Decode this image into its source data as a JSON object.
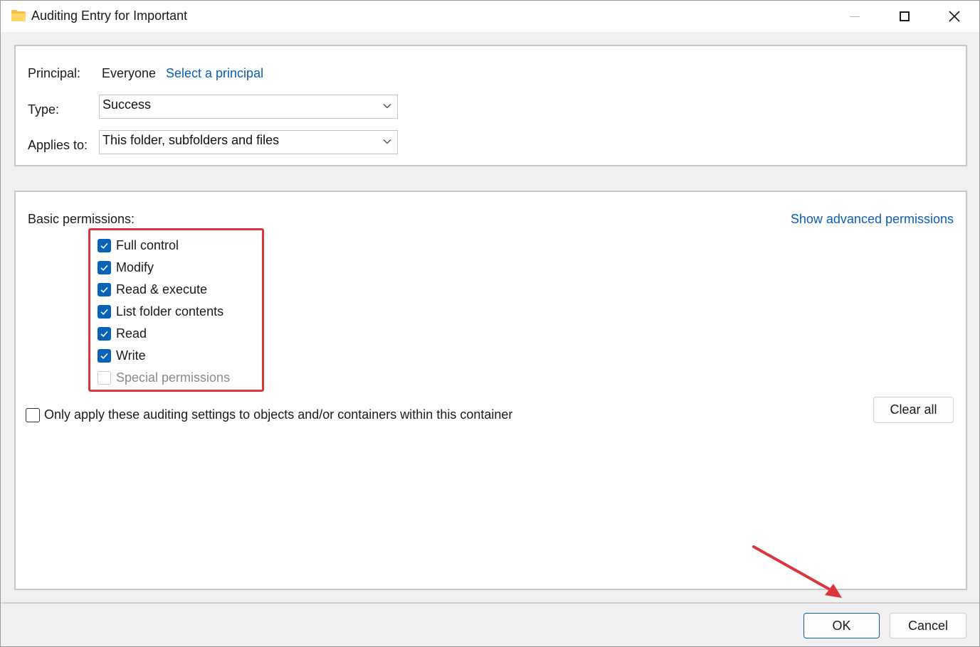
{
  "window": {
    "title": "Auditing Entry for Important"
  },
  "principal": {
    "label": "Principal:",
    "value": "Everyone",
    "link": "Select a principal"
  },
  "type": {
    "label": "Type:",
    "selected": "Success"
  },
  "applies_to": {
    "label": "Applies to:",
    "selected": "This folder, subfolders and files"
  },
  "permissions": {
    "heading": "Basic permissions:",
    "advanced_link": "Show advanced permissions",
    "items": [
      {
        "label": "Full control",
        "checked": true,
        "enabled": true
      },
      {
        "label": "Modify",
        "checked": true,
        "enabled": true
      },
      {
        "label": "Read & execute",
        "checked": true,
        "enabled": true
      },
      {
        "label": "List folder contents",
        "checked": true,
        "enabled": true
      },
      {
        "label": "Read",
        "checked": true,
        "enabled": true
      },
      {
        "label": "Write",
        "checked": true,
        "enabled": true
      },
      {
        "label": "Special permissions",
        "checked": false,
        "enabled": false
      }
    ]
  },
  "only_apply": {
    "label": "Only apply these auditing settings to objects and/or containers within this container",
    "checked": false
  },
  "buttons": {
    "clear_all": "Clear all",
    "ok": "OK",
    "cancel": "Cancel"
  },
  "colors": {
    "accent": "#0862b8",
    "link": "#0a5fb4",
    "highlight": "#d9363e"
  }
}
